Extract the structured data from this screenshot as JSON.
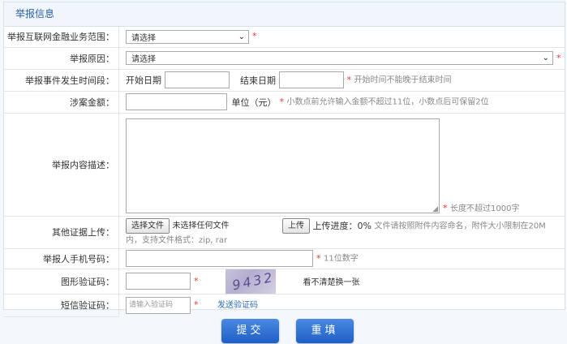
{
  "section_title": "举报信息",
  "rows": {
    "scope": {
      "label": "举报互联网金融业务范围：",
      "value": "请选择"
    },
    "reason": {
      "label": "举报原因：",
      "value": "请选择"
    },
    "period": {
      "label": "举报事件发生时间段：",
      "start_label": "开始日期",
      "end_label": "结束日期",
      "hint": "开始时间不能晚于结束时间"
    },
    "amount": {
      "label": "涉案金额：",
      "unit": "单位（元）",
      "hint": "小数点前允许输入金额不超过11位，小数点后可保留2位"
    },
    "description": {
      "label": "举报内容描述：",
      "hint": "长度不超过1000字"
    },
    "evidence": {
      "label": "其他证据上传：",
      "choose_button": "选择文件",
      "no_file_text": "未选择任何文件",
      "upload_button": "上传",
      "progress_text": "上传进度：0%",
      "hint_line1": "文件请按照附件内容命名，附件大小限制在20M",
      "hint_line2": "内，支持文件格式：zip, rar"
    },
    "phone": {
      "label": "举报人手机号码：",
      "hint": "11位数字"
    },
    "captcha": {
      "label": "图形验证码：",
      "image_text": "9432",
      "refresh_text": "看不清楚换一张"
    },
    "sms": {
      "label": "短信验证码：",
      "placeholder": "请输入验证码",
      "send_link": "发送验证码"
    }
  },
  "required_mark": "*",
  "buttons": {
    "submit": "提交",
    "reset": "重填"
  }
}
